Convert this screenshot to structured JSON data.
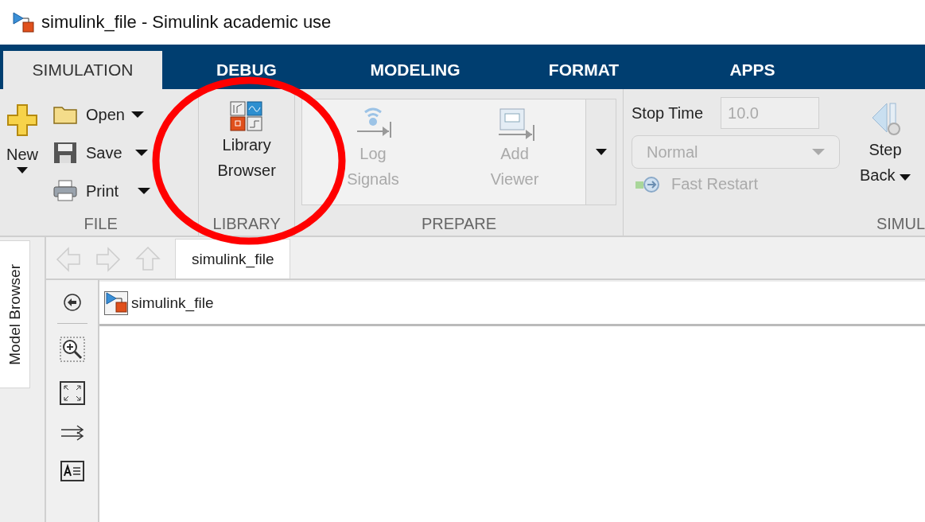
{
  "window": {
    "title": "simulink_file - Simulink academic use"
  },
  "tabs": [
    {
      "label": "SIMULATION",
      "selected": true
    },
    {
      "label": "DEBUG",
      "selected": false
    },
    {
      "label": "MODELING",
      "selected": false
    },
    {
      "label": "FORMAT",
      "selected": false
    },
    {
      "label": "APPS",
      "selected": false
    }
  ],
  "file_section": {
    "label": "FILE",
    "new_button": {
      "label": "New"
    },
    "items": [
      {
        "label": "Open",
        "kind": "open"
      },
      {
        "label": "Save",
        "kind": "save"
      },
      {
        "label": "Print",
        "kind": "print"
      }
    ]
  },
  "library_section": {
    "label": "LIBRARY",
    "button": {
      "label": "Library Browser"
    }
  },
  "prepare_section": {
    "label": "PREPARE",
    "buttons": [
      {
        "label": "Log Signals",
        "kind": "log",
        "disabled": true
      },
      {
        "label": "Add Viewer",
        "kind": "viewer",
        "disabled": true
      }
    ]
  },
  "simulate_section": {
    "label": "SIMUL",
    "stop_time": {
      "label": "Stop Time",
      "value": "10.0",
      "disabled": true
    },
    "mode": {
      "value": "Normal",
      "disabled": true
    },
    "fast_restart": {
      "label": "Fast Restart",
      "disabled": true
    },
    "step_back": {
      "label": "Step Back"
    }
  },
  "side_tab": {
    "label": "Model Browser"
  },
  "editor": {
    "tab": {
      "label": "simulink_file",
      "selected": true
    },
    "breadcrumb": "simulink_file"
  }
}
